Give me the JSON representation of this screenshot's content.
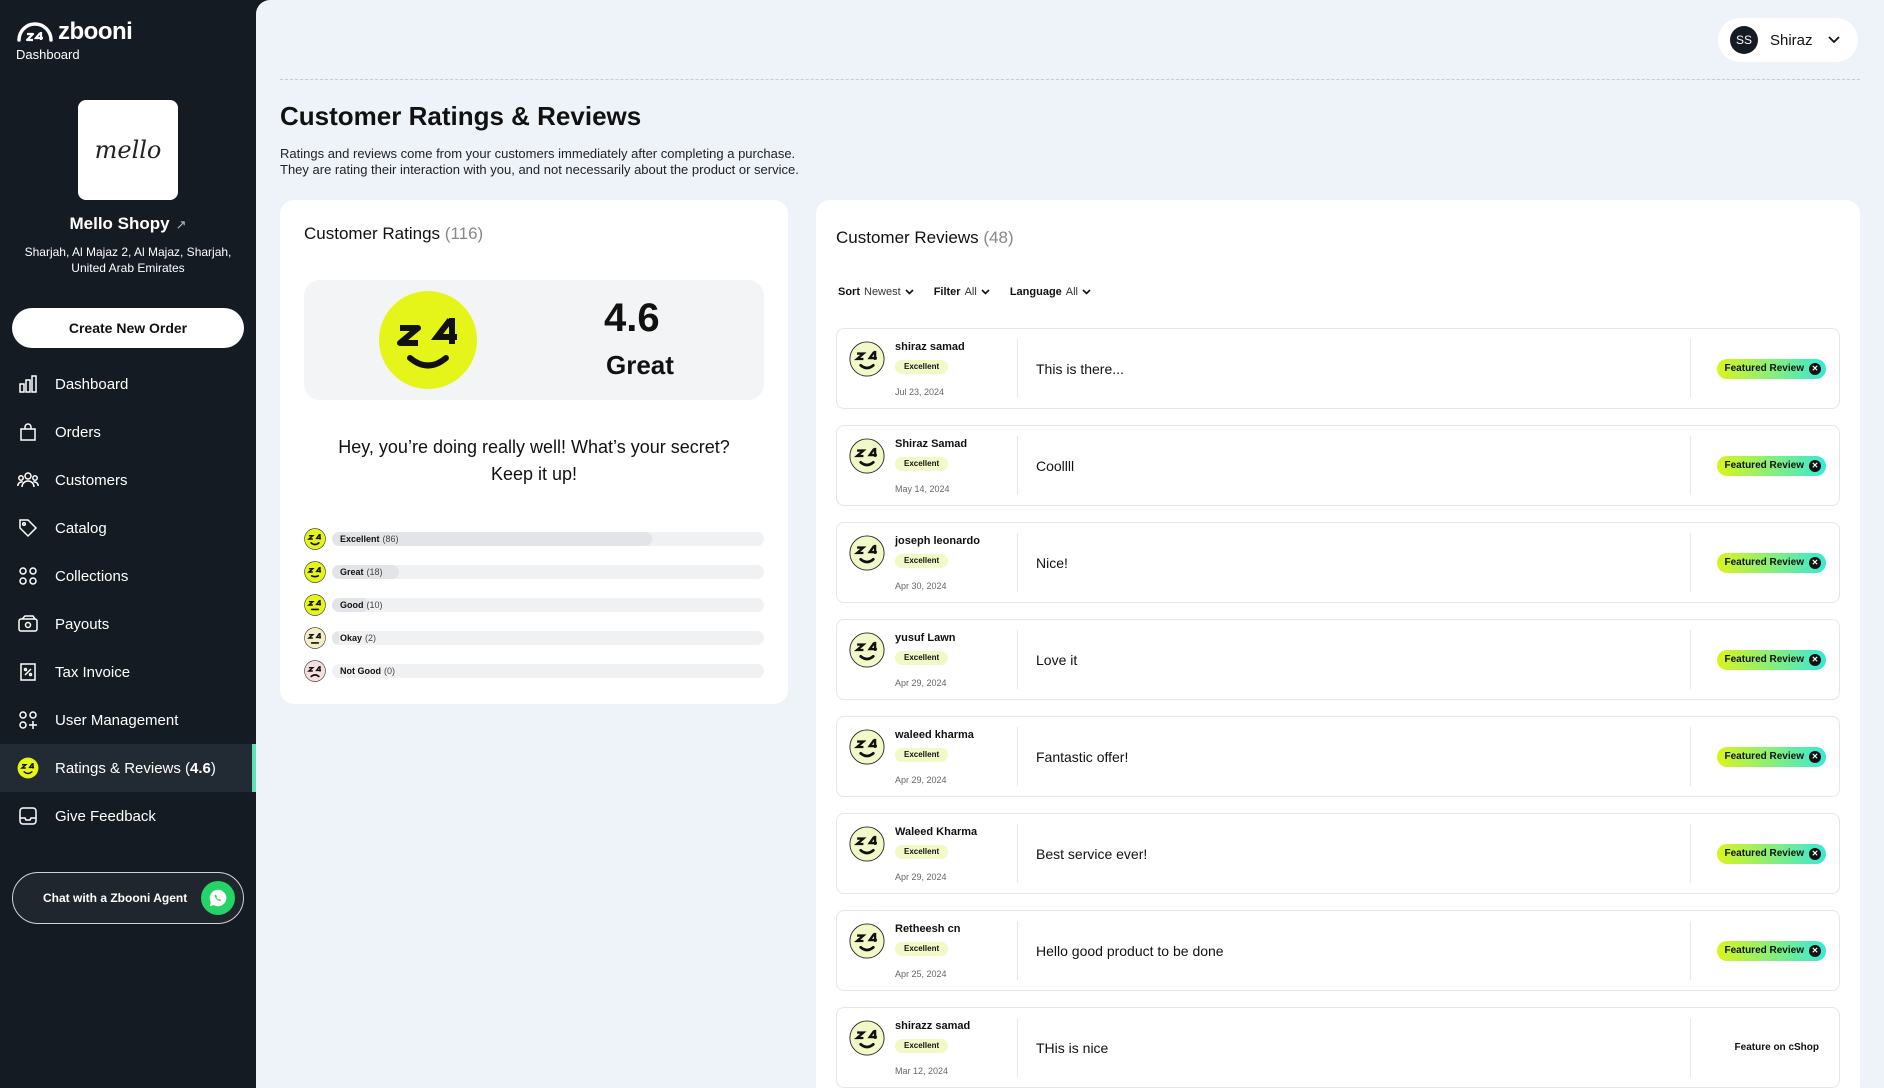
{
  "brand": {
    "name": "zbooni",
    "subtitle": "Dashboard"
  },
  "shop": {
    "logo_text": "mello",
    "name": "Mello Shopy",
    "address": "Sharjah, Al Majaz 2, Al Majaz, Sharjah, United Arab Emirates"
  },
  "create_order_label": "Create New Order",
  "nav": [
    {
      "label": "Dashboard",
      "icon": "bar-chart-icon"
    },
    {
      "label": "Orders",
      "icon": "shopping-bag-icon"
    },
    {
      "label": "Customers",
      "icon": "users-icon"
    },
    {
      "label": "Catalog",
      "icon": "tag-icon"
    },
    {
      "label": "Collections",
      "icon": "grid-icon"
    },
    {
      "label": "Payouts",
      "icon": "wallet-icon"
    },
    {
      "label": "Tax Invoice",
      "icon": "receipt-icon"
    },
    {
      "label": "User Management",
      "icon": "user-management-icon"
    },
    {
      "label": "Ratings & Reviews (",
      "bold": "4.6",
      "suffix": ")",
      "icon": "rating-face-icon",
      "active": true
    },
    {
      "label": "Give Feedback",
      "icon": "feedback-icon"
    }
  ],
  "chat_label": "Chat with a Zbooni Agent",
  "user": {
    "initials": "SS",
    "name": "Shiraz"
  },
  "page": {
    "title": "Customer Ratings & Reviews",
    "desc_line1": "Ratings and reviews come from your customers immediately after completing a purchase.",
    "desc_line2": "They are rating their interaction with you, and not necessarily about the product or service."
  },
  "ratings": {
    "title": "Customer Ratings",
    "count": "(116)",
    "score": "4.6",
    "score_word": "Great",
    "message_line1": "Hey, you’re doing really well! What’s your secret?",
    "message_line2": "Keep it up!",
    "breakdown": [
      {
        "label": "Excellent",
        "count": "(86)",
        "value": 86,
        "face": "excellent"
      },
      {
        "label": "Great",
        "count": "(18)",
        "value": 18,
        "face": "great"
      },
      {
        "label": "Good",
        "count": "(10)",
        "value": 10,
        "face": "good"
      },
      {
        "label": "Okay",
        "count": "(2)",
        "value": 2,
        "face": "okay"
      },
      {
        "label": "Not Good",
        "count": "(0)",
        "value": 0,
        "face": "notgood"
      }
    ]
  },
  "reviews": {
    "title": "Customer Reviews",
    "count": "(48)",
    "filters": [
      {
        "key": "Sort",
        "value": "Newest"
      },
      {
        "key": "Filter",
        "value": "All"
      },
      {
        "key": "Language",
        "value": "All"
      }
    ],
    "items": [
      {
        "name": "shiraz samad",
        "badge": "Excellent",
        "date": "Jul 23, 2024",
        "text": "This is there...",
        "action": "Featured Review",
        "featured": true
      },
      {
        "name": "Shiraz Samad",
        "badge": "Excellent",
        "date": "May 14, 2024",
        "text": "Coollll",
        "action": "Featured Review",
        "featured": true
      },
      {
        "name": "joseph leonardo",
        "badge": "Excellent",
        "date": "Apr 30, 2024",
        "text": "Nice!",
        "action": "Featured Review",
        "featured": true
      },
      {
        "name": "yusuf Lawn",
        "badge": "Excellent",
        "date": "Apr 29, 2024",
        "text": "Love it",
        "action": "Featured Review",
        "featured": true
      },
      {
        "name": "waleed kharma",
        "badge": "Excellent",
        "date": "Apr 29, 2024",
        "text": "Fantastic offer!",
        "action": "Featured Review",
        "featured": true
      },
      {
        "name": "Waleed Kharma",
        "badge": "Excellent",
        "date": "Apr 29, 2024",
        "text": "Best service ever!",
        "action": "Featured Review",
        "featured": true
      },
      {
        "name": "Retheesh cn",
        "badge": "Excellent",
        "date": "Apr 25, 2024",
        "text": "Hello good product to be done",
        "action": "Featured Review",
        "featured": true
      },
      {
        "name": "shirazz samad",
        "badge": "Excellent",
        "date": "Mar 12, 2024",
        "text": "THis is nice",
        "action": "Feature on cShop",
        "featured": false
      }
    ]
  },
  "colors": {
    "sidebar_bg": "#151b23",
    "main_bg": "#eef2f9",
    "accent_yellow": "#e5f51a",
    "active_marker": "#5fe3b5",
    "featured_gradient_start": "#d9f51c",
    "featured_gradient_end": "#37e8d6"
  }
}
